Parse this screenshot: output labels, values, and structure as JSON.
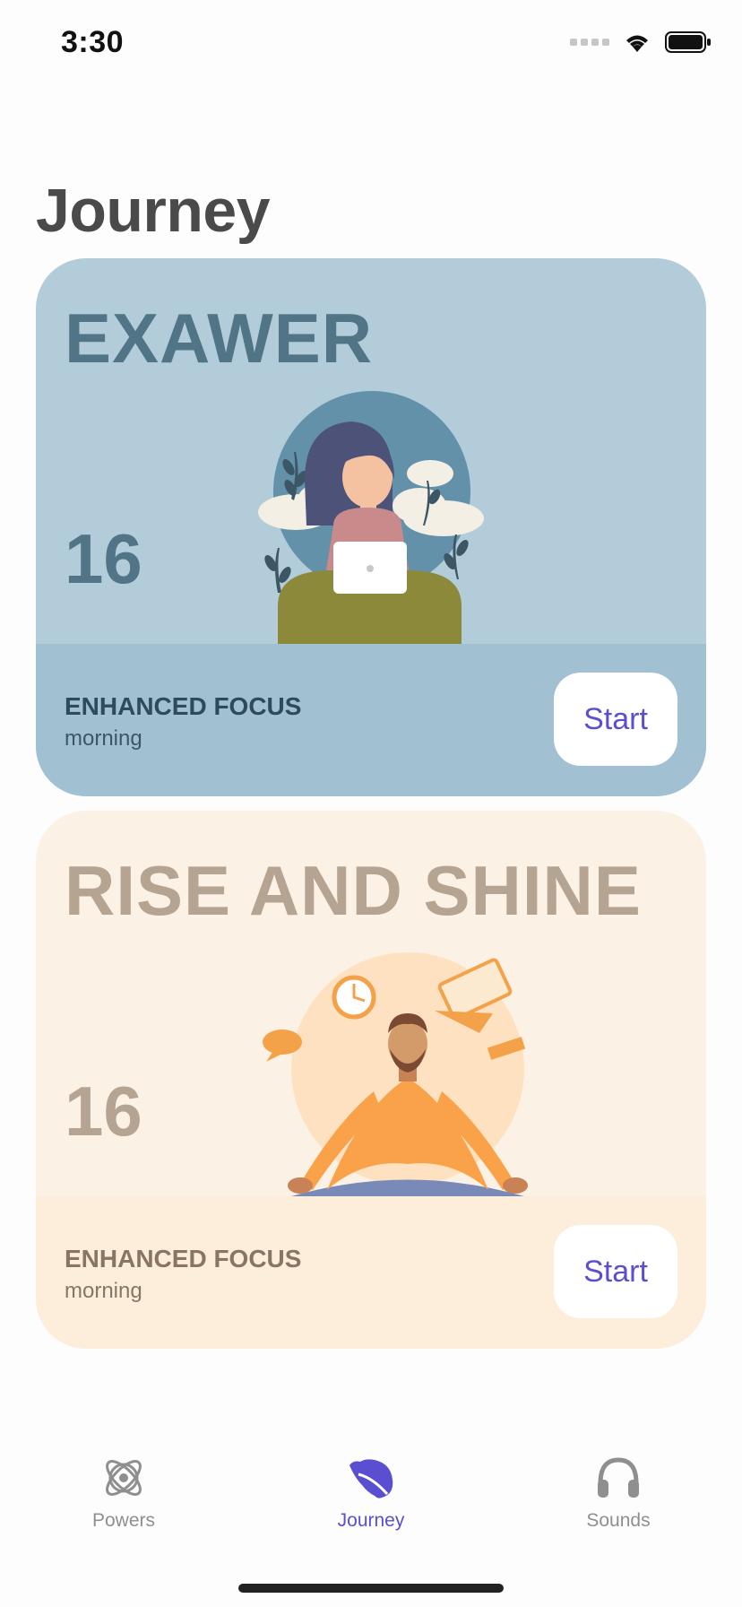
{
  "status_bar": {
    "time": "3:30"
  },
  "page": {
    "title": "Journey"
  },
  "cards": [
    {
      "title": "EXAWER",
      "count": "16",
      "subtitle": "ENHANCED FOCUS",
      "time_of_day": "morning",
      "button_label": "Start",
      "illustration": "meditating-woman-with-laptop",
      "background": "#b2cdd9"
    },
    {
      "title": "RISE AND SHINE",
      "count": "16",
      "subtitle": "ENHANCED FOCUS",
      "time_of_day": "morning",
      "button_label": "Start",
      "illustration": "meditating-man-with-floating-objects",
      "background": "#fcf1e5"
    }
  ],
  "tab_bar": {
    "items": [
      {
        "label": "Powers",
        "icon": "atom-icon",
        "active": false
      },
      {
        "label": "Journey",
        "icon": "leaf-icon",
        "active": true
      },
      {
        "label": "Sounds",
        "icon": "headphones-icon",
        "active": false
      }
    ]
  },
  "colors": {
    "accent": "#5a4fd0",
    "inactive_tab": "#8f8f8f"
  }
}
